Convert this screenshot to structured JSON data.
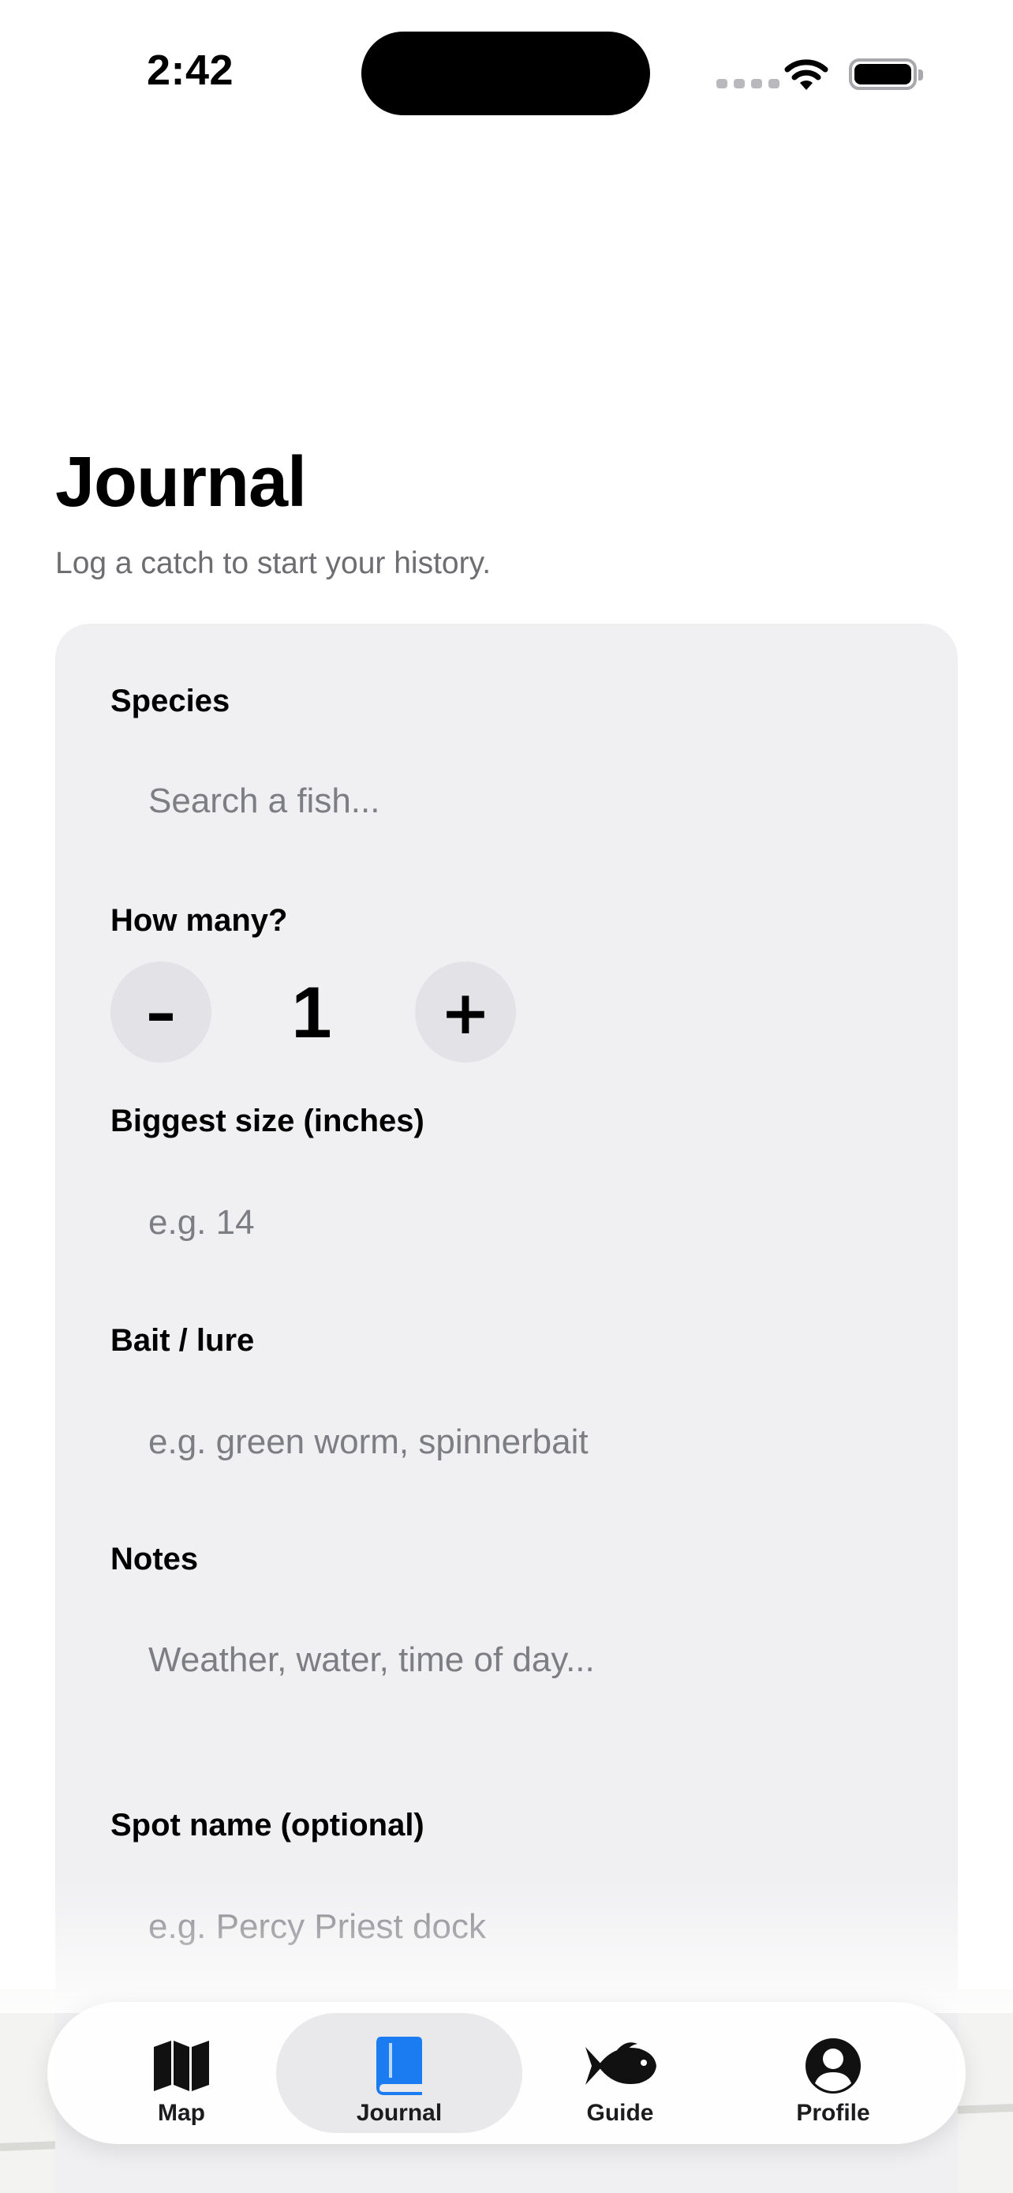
{
  "status_bar": {
    "time": "2:42"
  },
  "header": {
    "title": "Journal",
    "subtitle": "Log a catch to start your history."
  },
  "form": {
    "species": {
      "label": "Species",
      "placeholder": "Search a fish..."
    },
    "count": {
      "label": "How many?",
      "value": "1",
      "decrement_label": "–",
      "increment_label": "+"
    },
    "size": {
      "label": "Biggest size (inches)",
      "placeholder": "e.g. 14"
    },
    "bait": {
      "label": "Bait / lure",
      "placeholder": "e.g. green worm, spinnerbait"
    },
    "notes": {
      "label": "Notes",
      "placeholder": "Weather, water, time of day..."
    },
    "spot": {
      "label": "Spot name (optional)",
      "placeholder": "e.g. Percy Priest dock"
    }
  },
  "tab_bar": {
    "active": "Journal",
    "tabs": [
      {
        "label": "Map",
        "icon": "map-icon"
      },
      {
        "label": "Journal",
        "icon": "book-icon"
      },
      {
        "label": "Guide",
        "icon": "fish-icon"
      },
      {
        "label": "Profile",
        "icon": "person-circle-icon"
      }
    ]
  },
  "colors": {
    "accent": "#1a7cf0",
    "card_background": "#f0f0f2",
    "secondary_text": "#6d6d72"
  }
}
